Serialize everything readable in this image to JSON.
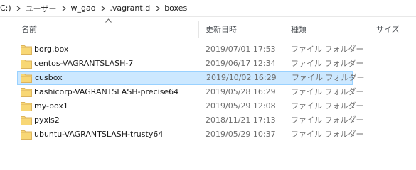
{
  "breadcrumb": [
    "C:)",
    "ユーザー",
    "w_gao",
    ".vagrant.d",
    "boxes"
  ],
  "columns": {
    "name": "名前",
    "date": "更新日時",
    "type": "種類",
    "size": "サイズ"
  },
  "files": [
    {
      "name": "borg.box",
      "date": "2019/07/01 17:53",
      "type": "ファイル フォルダー"
    },
    {
      "name": "centos-VAGRANTSLASH-7",
      "date": "2019/06/17 12:34",
      "type": "ファイル フォルダー"
    },
    {
      "name": "cusbox",
      "date": "2019/10/02 16:29",
      "type": "ファイル フォルダー",
      "selected": true
    },
    {
      "name": "hashicorp-VAGRANTSLASH-precise64",
      "date": "2019/05/28 16:29",
      "type": "ファイル フォルダー"
    },
    {
      "name": "my-box1",
      "date": "2019/05/29 12:08",
      "type": "ファイル フォルダー"
    },
    {
      "name": "pyxis2",
      "date": "2018/11/21 17:13",
      "type": "ファイル フォルダー"
    },
    {
      "name": "ubuntu-VAGRANTSLASH-trusty64",
      "date": "2019/05/29 10:37",
      "type": "ファイル フォルダー"
    }
  ],
  "colors": {
    "selection_bg": "#cce8ff",
    "selection_border": "#99d1ff",
    "folder": "#f8d775"
  },
  "icons": {
    "separator": "chevron-right-icon",
    "sort": "sort-ascending-icon",
    "folder": "folder-icon"
  }
}
